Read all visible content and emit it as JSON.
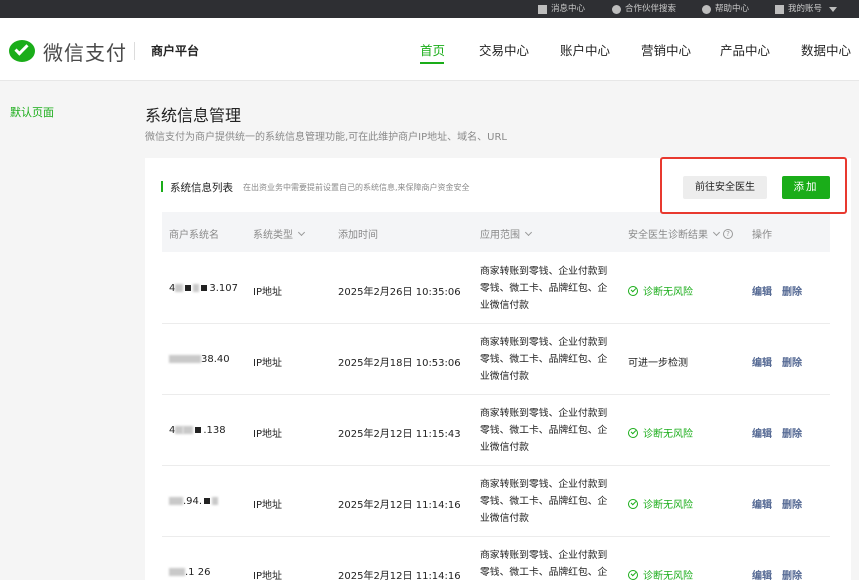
{
  "topbar": {
    "messages": "消息中心",
    "partner_search": "合作伙伴搜索",
    "help": "帮助中心",
    "account": "我的账号"
  },
  "header": {
    "logo_text": "微信支付",
    "platform": "商户平台",
    "nav": [
      "首页",
      "交易中心",
      "账户中心",
      "营销中心",
      "产品中心",
      "数据中心"
    ]
  },
  "sidebar": {
    "default_page": "默认页面"
  },
  "main": {
    "title": "系统信息管理",
    "description": "微信支付为商户提供统一的系统信息管理功能,可在此维护商户IP地址、域名、URL",
    "panel_title": "系统信息列表",
    "panel_subtitle": "在出资业务中需要提前设置自己的系统信息,来保障商户资金安全",
    "doctor_button": "前往安全医生",
    "add_button": "添加"
  },
  "table": {
    "headers": {
      "name": "商户系统名",
      "type": "系统类型",
      "time": "添加时间",
      "scope": "应用范围",
      "result": "安全医生诊断结果",
      "ops": "操作"
    },
    "rows": [
      {
        "name_prefix": "4",
        "name_suffix": "3.107",
        "type": "IP地址",
        "time": "2025年2月26日 10:35:06",
        "scope": "商家转账到零钱、企业付款到零钱、微工卡、品牌红包、企业微信付款",
        "result": "诊断无风险",
        "result_ok": true,
        "edit": "编辑",
        "delete": "删除"
      },
      {
        "name_prefix": "",
        "name_suffix": "38.40",
        "type": "IP地址",
        "time": "2025年2月18日 10:53:06",
        "scope": "商家转账到零钱、企业付款到零钱、微工卡、品牌红包、企业微信付款",
        "result": "可进一步检测",
        "result_ok": false,
        "edit": "编辑",
        "delete": "删除"
      },
      {
        "name_prefix": "4",
        "name_suffix": ".138",
        "type": "IP地址",
        "time": "2025年2月12日 11:15:43",
        "scope": "商家转账到零钱、企业付款到零钱、微工卡、品牌红包、企业微信付款",
        "result": "诊断无风险",
        "result_ok": true,
        "edit": "编辑",
        "delete": "删除"
      },
      {
        "name_prefix": "",
        "name_suffix": ".94.",
        "type": "IP地址",
        "time": "2025年2月12日 11:14:16",
        "scope": "商家转账到零钱、企业付款到零钱、微工卡、品牌红包、企业微信付款",
        "result": "诊断无风险",
        "result_ok": true,
        "edit": "编辑",
        "delete": "删除"
      },
      {
        "name_prefix": "",
        "name_suffix": ".1 26",
        "type": "IP地址",
        "time": "2025年2月12日 11:14:16",
        "scope": "商家转账到零钱、企业付款到零钱、微工卡、品牌红包、企业微信付款",
        "result": "诊断无风险",
        "result_ok": true,
        "edit": "编辑",
        "delete": "删除"
      }
    ]
  },
  "colors": {
    "brand": "#1aad19",
    "link": "#576b95",
    "highlight": "#e8392f"
  }
}
